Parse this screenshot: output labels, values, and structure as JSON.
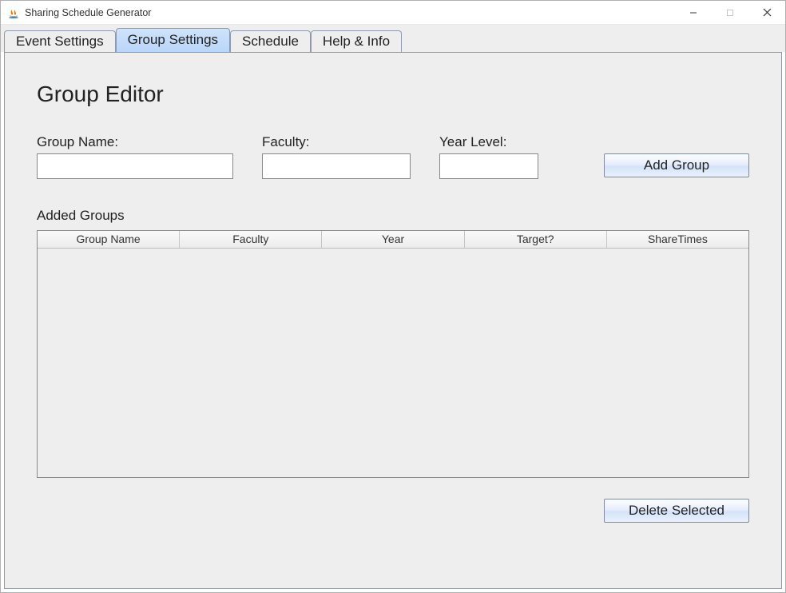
{
  "window": {
    "title": "Sharing Schedule Generator"
  },
  "tabs": [
    {
      "label": "Event Settings",
      "active": false
    },
    {
      "label": "Group Settings",
      "active": true
    },
    {
      "label": "Schedule",
      "active": false
    },
    {
      "label": "Help & Info",
      "active": false
    }
  ],
  "editor": {
    "heading": "Group Editor",
    "group_name_label": "Group Name:",
    "group_name_value": "",
    "faculty_label": "Faculty:",
    "faculty_value": "",
    "year_level_label": "Year Level:",
    "year_level_value": "",
    "add_button": "Add Group",
    "added_groups_label": "Added Groups",
    "delete_button": "Delete Selected",
    "table": {
      "columns": [
        "Group Name",
        "Faculty",
        "Year",
        "Target?",
        "ShareTimes"
      ],
      "rows": []
    }
  },
  "icons": {
    "java": "java-icon",
    "minimize": "minimize-icon",
    "maximize": "maximize-icon",
    "close": "close-icon"
  }
}
